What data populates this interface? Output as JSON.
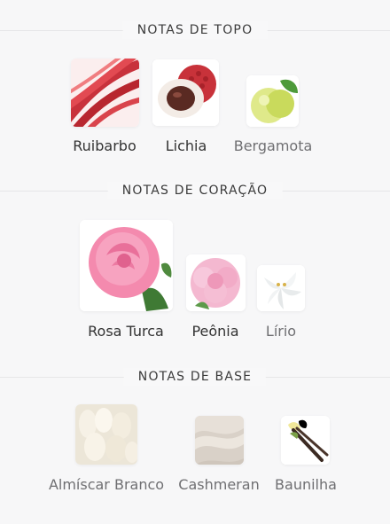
{
  "sections": [
    {
      "title": "NOTAS DE TOPO",
      "notes": [
        {
          "name": "Ruibarbo",
          "icon": "rhubarb-icon"
        },
        {
          "name": "Lichia",
          "icon": "lychee-icon"
        },
        {
          "name": "Bergamota",
          "icon": "bergamot-icon"
        }
      ]
    },
    {
      "title": "NOTAS DE CORAÇÃO",
      "notes": [
        {
          "name": "Rosa Turca",
          "icon": "rose-icon"
        },
        {
          "name": "Peônia",
          "icon": "peony-icon"
        },
        {
          "name": "Lírio",
          "icon": "lily-icon"
        }
      ]
    },
    {
      "title": "NOTAS DE BASE",
      "notes": [
        {
          "name": "Almíscar Branco",
          "icon": "white-musk-icon"
        },
        {
          "name": "Cashmeran",
          "icon": "cashmeran-icon"
        },
        {
          "name": "Baunilha",
          "icon": "vanilla-icon"
        }
      ]
    }
  ],
  "colors": {
    "background": "#f7f7f8",
    "title_text": "#3a3a3a",
    "primary_label": "#333333",
    "secondary_label": "#6f6f72"
  }
}
